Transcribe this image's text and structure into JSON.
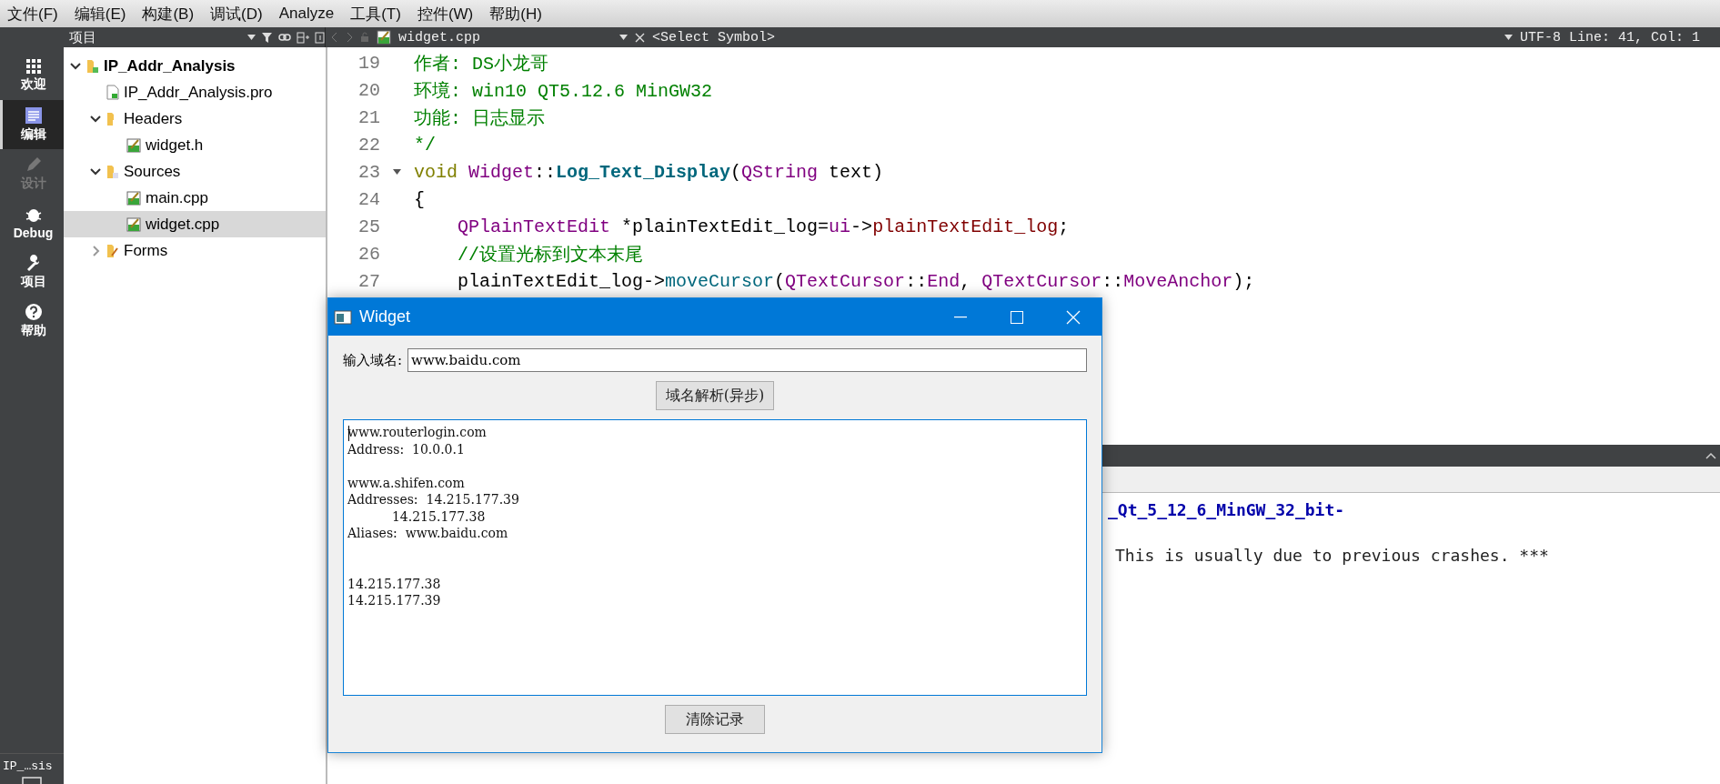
{
  "menu": [
    "文件(F)",
    "编辑(E)",
    "构建(B)",
    "调试(D)",
    "Analyze",
    "工具(T)",
    "控件(W)",
    "帮助(H)"
  ],
  "toolbar": {
    "panel_title": "项目",
    "file_name": "widget.cpp",
    "symbol": "<Select Symbol>",
    "status": "UTF-8 Line: 41, Col: 1"
  },
  "mode_bar": {
    "items": [
      {
        "kind": "welcome",
        "label": "欢迎",
        "selected": false,
        "disabled": false
      },
      {
        "kind": "edit",
        "label": "编辑",
        "selected": true,
        "disabled": false
      },
      {
        "kind": "design",
        "label": "设计",
        "selected": false,
        "disabled": true
      },
      {
        "kind": "debug",
        "label": "Debug",
        "selected": false,
        "disabled": false
      },
      {
        "kind": "projects",
        "label": "项目",
        "selected": false,
        "disabled": false
      },
      {
        "kind": "help",
        "label": "帮助",
        "selected": false,
        "disabled": false
      }
    ],
    "session": "IP_…sis"
  },
  "project_tree": [
    {
      "label": "IP_Addr_Analysis",
      "kind": "project",
      "expanded": true,
      "selected": false,
      "children": [
        {
          "label": "IP_Addr_Analysis.pro",
          "kind": "pro",
          "selected": false
        },
        {
          "label": "Headers",
          "kind": "headers",
          "expanded": true,
          "selected": false,
          "children": [
            {
              "label": "widget.h",
              "kind": "file",
              "selected": false
            }
          ]
        },
        {
          "label": "Sources",
          "kind": "sources",
          "expanded": true,
          "selected": false,
          "children": [
            {
              "label": "main.cpp",
              "kind": "file",
              "selected": false
            },
            {
              "label": "widget.cpp",
              "kind": "file",
              "selected": true
            }
          ]
        },
        {
          "label": "Forms",
          "kind": "forms",
          "expanded": false,
          "selected": false
        }
      ]
    }
  ],
  "editor": {
    "lines": [
      {
        "number": "19",
        "foldable": false,
        "tokens": [
          {
            "kind": "comment",
            "text": "作者: DS小龙哥"
          }
        ]
      },
      {
        "number": "20",
        "foldable": false,
        "tokens": [
          {
            "kind": "comment",
            "text": "环境: win10 QT5.12.6 MinGW32"
          }
        ]
      },
      {
        "number": "21",
        "foldable": false,
        "tokens": [
          {
            "kind": "comment",
            "text": "功能: 日志显示"
          }
        ]
      },
      {
        "number": "22",
        "foldable": false,
        "tokens": [
          {
            "kind": "comment",
            "text": "*/"
          }
        ]
      },
      {
        "number": "23",
        "foldable": true,
        "tokens": [
          {
            "kind": "keyword",
            "text": "void "
          },
          {
            "kind": "type",
            "text": "Widget"
          },
          {
            "kind": "plain",
            "text": "::"
          },
          {
            "kind": "function",
            "text": "Log_Text_Display"
          },
          {
            "kind": "plain",
            "text": "("
          },
          {
            "kind": "type",
            "text": "QString"
          },
          {
            "kind": "plain",
            "text": " text)"
          }
        ]
      },
      {
        "number": "24",
        "foldable": false,
        "tokens": [
          {
            "kind": "plain",
            "text": "{"
          }
        ]
      },
      {
        "number": "25",
        "foldable": false,
        "tokens": [
          {
            "kind": "type",
            "text": "    QPlainTextEdit"
          },
          {
            "kind": "plain",
            "text": " *plainTextEdit_log="
          },
          {
            "kind": "type",
            "text": "ui"
          },
          {
            "kind": "plain",
            "text": "->"
          },
          {
            "kind": "field",
            "text": "plainTextEdit_log"
          },
          {
            "kind": "plain",
            "text": ";"
          }
        ]
      },
      {
        "number": "26",
        "foldable": false,
        "tokens": [
          {
            "kind": "comment",
            "text": "    //设置光标到文本末尾"
          }
        ]
      },
      {
        "number": "27",
        "foldable": false,
        "tokens": [
          {
            "kind": "plain",
            "text": "    plainTextEdit_log->"
          },
          {
            "kind": "method",
            "text": "moveCursor"
          },
          {
            "kind": "plain",
            "text": "("
          },
          {
            "kind": "type",
            "text": "QTextCursor"
          },
          {
            "kind": "plain",
            "text": "::"
          },
          {
            "kind": "type",
            "text": "End"
          },
          {
            "kind": "plain",
            "text": ", "
          },
          {
            "kind": "type",
            "text": "QTextCursor"
          },
          {
            "kind": "plain",
            "text": "::"
          },
          {
            "kind": "type",
            "text": "MoveAnchor"
          },
          {
            "kind": "plain",
            "text": ");"
          }
        ]
      }
    ]
  },
  "output": {
    "lines": [
      {
        "kind": "path",
        "text": "_Qt_5_12_6_MinGW_32_bit-"
      },
      {
        "kind": "message",
        "text": "This is usually due to previous crashes. ***"
      }
    ]
  },
  "widget_window": {
    "title": "Widget",
    "domain_label": "输入域名:",
    "domain_value": "www.baidu.com",
    "resolve_button": "域名解析(异步)",
    "log_text": "www.routerlogin.com\nAddress:  10.0.0.1\n\nwww.a.shifen.com\nAddresses:  14.215.177.39\n           14.215.177.38\nAliases:  www.baidu.com\n\n\n14.215.177.38\n14.215.177.39",
    "clear_button": "清除记录"
  }
}
